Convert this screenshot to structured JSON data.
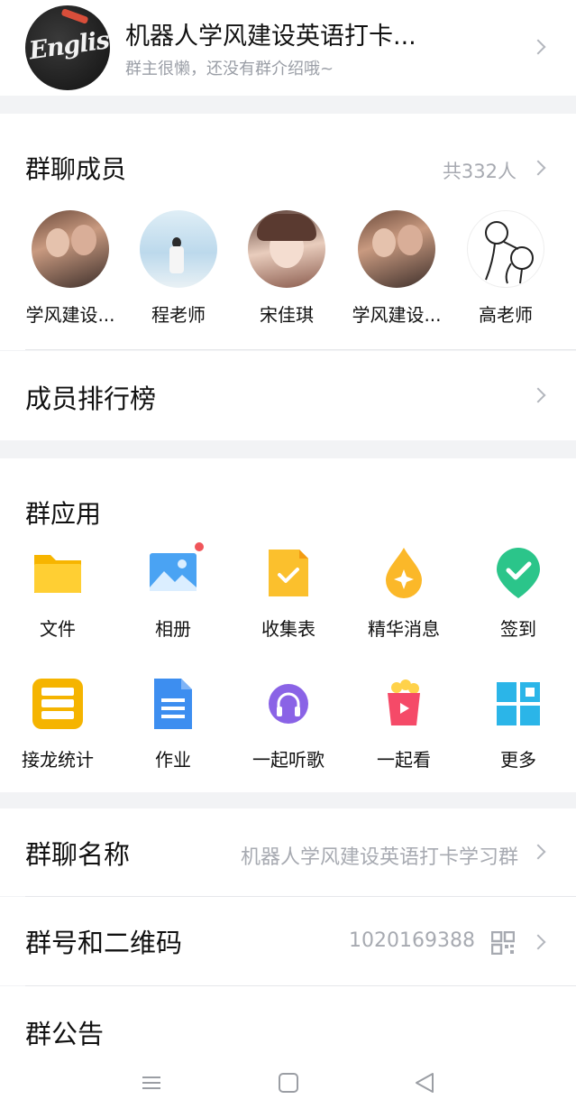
{
  "header": {
    "title": "机器人学风建设英语打卡...",
    "subtitle": "群主很懒，还没有群介绍哦~",
    "avatar_text": "English"
  },
  "members": {
    "title": "群聊成员",
    "count": "共332人",
    "list": [
      {
        "name": "学风建设..."
      },
      {
        "name": "程老师"
      },
      {
        "name": "宋佳琪"
      },
      {
        "name": "学风建设..."
      },
      {
        "name": "高老师"
      }
    ]
  },
  "ranking": {
    "title": "成员排行榜"
  },
  "apps": {
    "title": "群应用",
    "items": [
      {
        "label": "文件",
        "icon": "folder-icon"
      },
      {
        "label": "相册",
        "icon": "album-icon",
        "badge": true
      },
      {
        "label": "收集表",
        "icon": "form-icon"
      },
      {
        "label": "精华消息",
        "icon": "essence-icon"
      },
      {
        "label": "签到",
        "icon": "checkin-icon"
      },
      {
        "label": "接龙统计",
        "icon": "relay-icon"
      },
      {
        "label": "作业",
        "icon": "homework-icon"
      },
      {
        "label": "一起听歌",
        "icon": "headphones-icon"
      },
      {
        "label": "一起看",
        "icon": "popcorn-icon"
      },
      {
        "label": "更多",
        "icon": "grid-icon"
      }
    ]
  },
  "group_name": {
    "label": "群聊名称",
    "value": "机器人学风建设英语打卡学习群"
  },
  "group_number": {
    "label": "群号和二维码",
    "value": "1020169388"
  },
  "notice": {
    "label": "群公告"
  },
  "colors": {
    "accent_green": "#2bc58a",
    "accent_yellow": "#fbc02d",
    "accent_blue": "#3d8ef0",
    "badge_red": "#f0555a"
  }
}
